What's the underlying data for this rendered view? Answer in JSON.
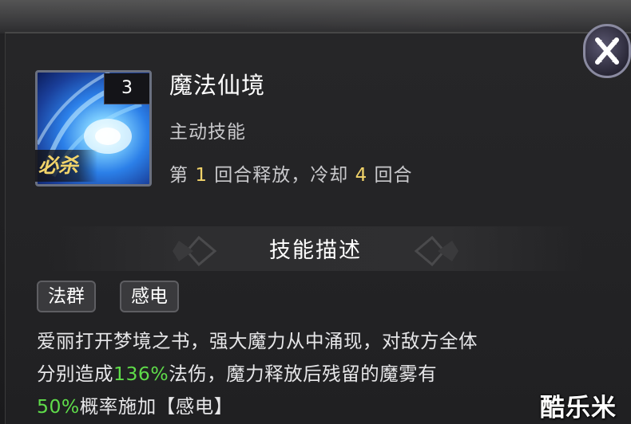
{
  "skill": {
    "name": "魔法仙境",
    "type": "主动技能",
    "timing": {
      "prefix": "第 ",
      "release_turn": "1",
      "middle": " 回合释放，冷却 ",
      "cooldown_turns": "4",
      "suffix": " 回合"
    },
    "level": "3",
    "ultimate_badge": "必杀",
    "icon": "blue-magic-vortex-icon"
  },
  "section": {
    "title": "技能描述"
  },
  "tags": [
    "法群",
    "感电"
  ],
  "description": {
    "line1": "爱丽打开梦境之书，强大魔力从中涌现，对敌方全体",
    "line2_a": "分别造成",
    "line2_pct": "136%",
    "line2_b": "法伤，魔力释放后残留的魔雾有",
    "line3_pct": "50%",
    "line3_b": "概率施加【感电】"
  },
  "watermark": "酷乐米",
  "colors": {
    "highlight": "#5fdc4a",
    "number": "#f2d46a",
    "text": "#e6e6e8"
  },
  "close_icon": "close-x-icon"
}
